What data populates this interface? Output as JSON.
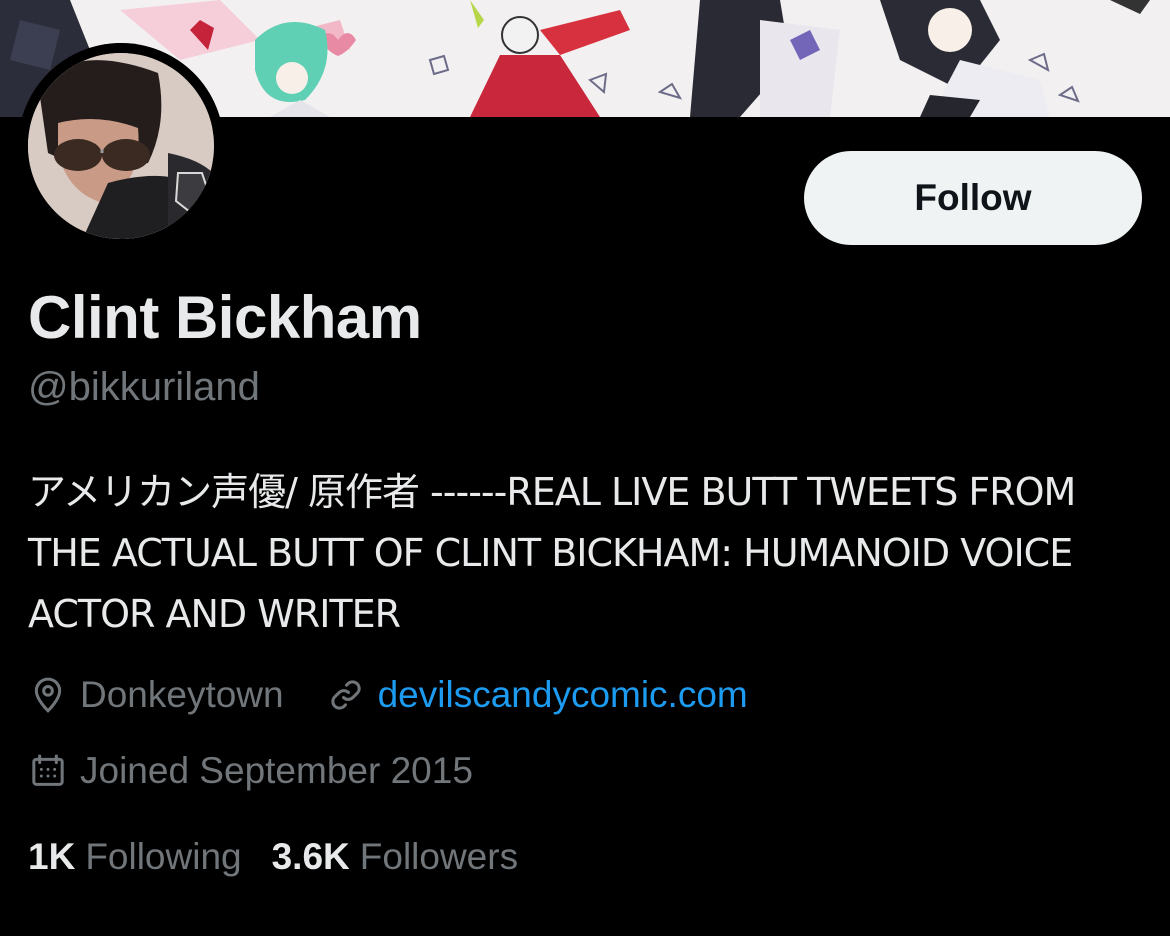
{
  "profile": {
    "name": "Clint Bickham",
    "handle": "@bikkuriland",
    "bio": "アメリカン声優/ 原作者 ------REAL LIVE BUTT TWEETS FROM THE ACTUAL BUTT OF CLINT BICKHAM: HUMANOID VOICE ACTOR AND WRITER",
    "location": "Donkeytown",
    "website": "devilscandycomic.com",
    "joined": "Joined September 2015"
  },
  "actions": {
    "follow_label": "Follow"
  },
  "stats": {
    "following_count": "1K",
    "following_label": "Following",
    "followers_count": "3.6K",
    "followers_label": "Followers"
  },
  "icons": {
    "location": "map-pin-icon",
    "website": "link-icon",
    "joined": "calendar-icon"
  },
  "colors": {
    "background": "#000000",
    "text_primary": "#e7e9ea",
    "text_secondary": "#71767b",
    "link": "#1d9bf0",
    "follow_button_bg": "#eff3f4"
  }
}
